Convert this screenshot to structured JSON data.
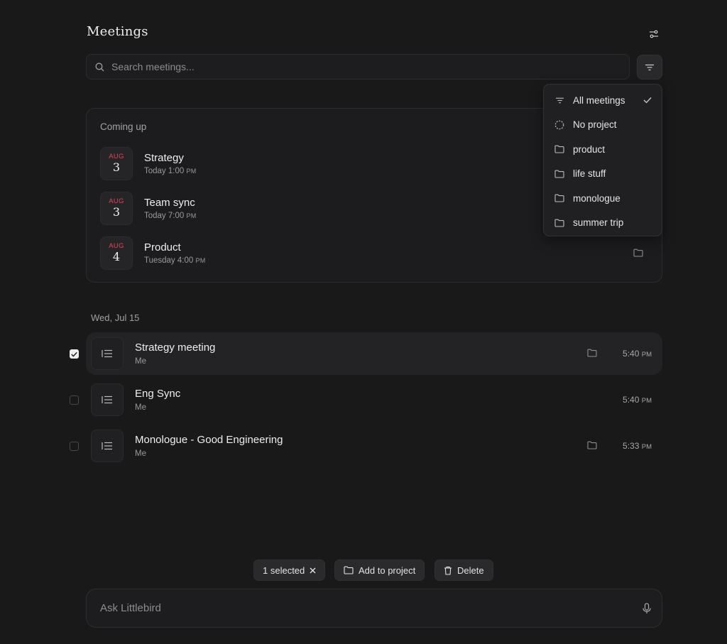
{
  "header": {
    "title": "Meetings",
    "settings_icon": "sliders-icon"
  },
  "search": {
    "placeholder": "Search meetings...",
    "value": ""
  },
  "filter_menu": {
    "items": [
      {
        "label": "All meetings",
        "icon": "filter-lines-icon",
        "checked": true
      },
      {
        "label": "No project",
        "icon": "dashed-circle-icon",
        "checked": false
      },
      {
        "label": "product",
        "icon": "folder-icon",
        "checked": false
      },
      {
        "label": "life stuff",
        "icon": "folder-icon",
        "checked": false
      },
      {
        "label": "monologue",
        "icon": "folder-icon",
        "checked": false
      },
      {
        "label": "summer trip",
        "icon": "folder-icon",
        "checked": false
      }
    ]
  },
  "upcoming": {
    "heading": "Coming up",
    "items": [
      {
        "month": "AUG",
        "day": "3",
        "name": "Strategy",
        "when": "Today 1:00",
        "ampm": "PM"
      },
      {
        "month": "AUG",
        "day": "3",
        "name": "Team sync",
        "when": "Today 7:00",
        "ampm": "PM"
      },
      {
        "month": "AUG",
        "day": "4",
        "name": "Product",
        "when": "Tuesday 4:00",
        "ampm": "PM"
      }
    ]
  },
  "past": {
    "date_heading": "Wed, Jul 15",
    "items": [
      {
        "name": "Strategy meeting",
        "sub": "Me",
        "time": "5:40",
        "ampm": "PM",
        "selected": true
      },
      {
        "name": "Eng Sync",
        "sub": "Me",
        "time": "5:40",
        "ampm": "PM",
        "selected": false
      },
      {
        "name": "Monologue - Good Engineering",
        "sub": "Me",
        "time": "5:33",
        "ampm": "PM",
        "selected": false
      }
    ]
  },
  "selection_bar": {
    "selected_label": "1 selected",
    "add_label": "Add to project",
    "delete_label": "Delete"
  },
  "ask": {
    "placeholder": "Ask Littlebird"
  },
  "colors": {
    "background": "#19191a",
    "month_accent": "#e0455a"
  }
}
